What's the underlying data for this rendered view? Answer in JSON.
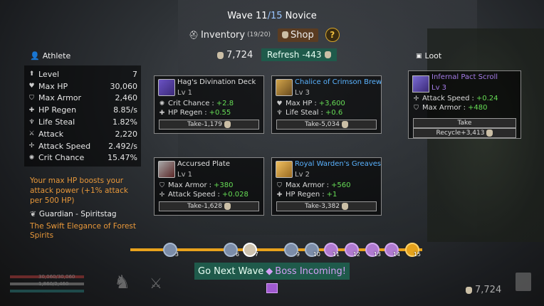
{
  "wave": {
    "label": "Wave",
    "current": "11",
    "total": "/15",
    "difficulty": "Novice"
  },
  "topbar": {
    "inventory_label": "Inventory",
    "inventory_count": "(19/20)",
    "shop_label": "Shop",
    "help_label": "?"
  },
  "gold": "7,724",
  "refresh": {
    "label": "Refresh",
    "cost": "-443"
  },
  "character": {
    "name": "Athlete",
    "stats": [
      {
        "label": "Level",
        "value": "7",
        "icon": "arrow-up-icon"
      },
      {
        "label": "Max HP",
        "value": "30,060",
        "icon": "heart-icon"
      },
      {
        "label": "Max Armor",
        "value": "2,460",
        "icon": "shield-icon"
      },
      {
        "label": "HP Regen",
        "value": "8.85/s",
        "icon": "regen-icon"
      },
      {
        "label": "Life Steal",
        "value": "1.82%",
        "icon": "lifesteal-icon"
      },
      {
        "label": "Attack",
        "value": "2,220",
        "icon": "sword-icon"
      },
      {
        "label": "Attack Speed",
        "value": "2.492/s",
        "icon": "attack-speed-icon"
      },
      {
        "label": "Crit Chance",
        "value": "15.47%",
        "icon": "crit-icon"
      }
    ],
    "hint": "Your max HP boosts your attack power (+1% attack per 500 HP)",
    "guardian": "Guardian - Spiritstag",
    "guardian_desc": "The Swift Elegance of Forest Spirits"
  },
  "shop_items": [
    {
      "name": "Hag's Divination Deck",
      "level": "Lv 1",
      "rarity": "common",
      "stat1_label": "Crit Chance",
      "stat1_value": "+2.8",
      "stat2_label": "HP Regen",
      "stat2_value": "+0.55",
      "take": "Take-1,179"
    },
    {
      "name": "Chalice of Crimson Brew",
      "level": "Lv 3",
      "rarity": "rare",
      "stat1_label": "Max HP",
      "stat1_value": "+3,600",
      "stat2_label": "Life Steal",
      "stat2_value": "+0.6",
      "take": "Take-5,034"
    },
    {
      "name": "Accursed Plate",
      "level": "Lv 1",
      "rarity": "common",
      "stat1_label": "Max Armor",
      "stat1_value": "+380",
      "stat2_label": "Attack Speed",
      "stat2_value": "+0.028",
      "take": "Take-1,628"
    },
    {
      "name": "Royal Warden's Greaves",
      "level": "Lv 2",
      "rarity": "rare",
      "stat1_label": "Max Armor",
      "stat1_value": "+560",
      "stat2_label": "HP Regen",
      "stat2_value": "+1",
      "take": "Take-3,382"
    }
  ],
  "loot": {
    "title": "Loot",
    "name": "Infernal Pact Scroll",
    "level": "Lv 3",
    "stat1_label": "Attack Speed",
    "stat1_value": "+0.24",
    "stat2_label": "Max Armor",
    "stat2_value": "+480",
    "take_label": "Take",
    "recycle_label": "Recycle+3,413"
  },
  "waves": [
    {
      "n": "3",
      "type": "normal"
    },
    {
      "n": "6",
      "type": "normal"
    },
    {
      "n": "7",
      "type": "done"
    },
    {
      "n": "9",
      "type": "normal"
    },
    {
      "n": "10",
      "type": "normal"
    },
    {
      "n": "11",
      "type": "boss"
    },
    {
      "n": "12",
      "type": "boss"
    },
    {
      "n": "13",
      "type": "boss"
    },
    {
      "n": "14",
      "type": "boss"
    },
    {
      "n": "15",
      "type": "final"
    }
  ],
  "next_wave": {
    "label": "Go Next Wave",
    "boss_label": "Boss Incoming!"
  },
  "hud": {
    "hp_text": "30,060/30,060",
    "armor_text": "1,860/2,460"
  },
  "colors": {
    "accent_green": "#1f5a4b",
    "stat_value": "#66dd55",
    "hint_orange": "#e8983a",
    "rare_blue": "#5ab3ff",
    "epic_purple": "#a57be8"
  }
}
